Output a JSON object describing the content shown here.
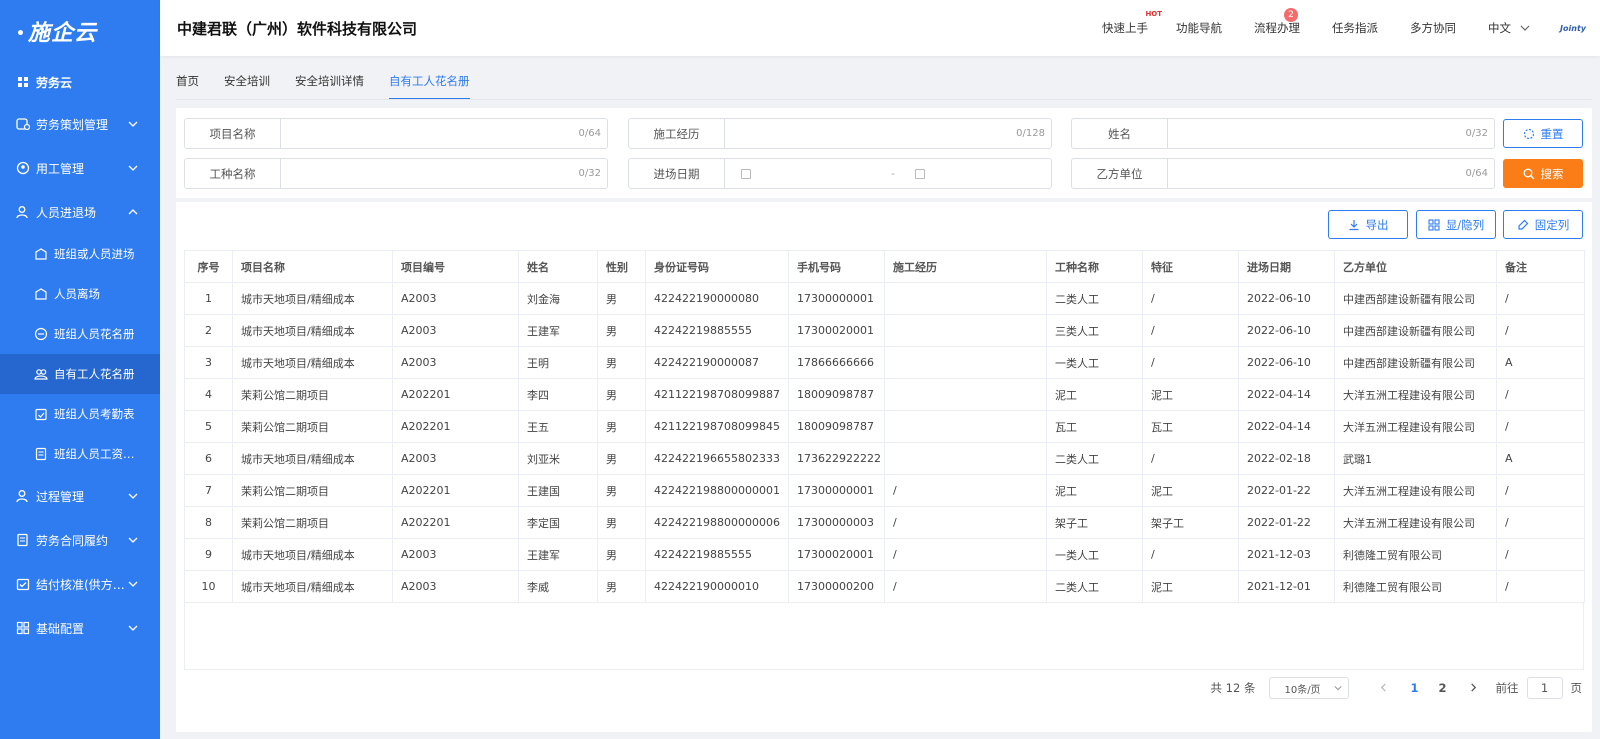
{
  "brand": {
    "logo": "施企云"
  },
  "company": "中建君联（广州）软件科技有限公司",
  "header_nav": {
    "quick_start": "快速上手",
    "hot": "HOT",
    "feature_nav": "功能导航",
    "process": "流程办理",
    "process_badge": "2",
    "tasks": "任务指派",
    "collab": "多方协同",
    "lang": "中文",
    "brand_mini": "Jointy"
  },
  "sidebar": {
    "items": [
      {
        "label": "劳务云",
        "icon": "grid-icon"
      },
      {
        "label": "劳务策划管理",
        "icon": "plan-icon"
      },
      {
        "label": "用工管理",
        "icon": "employ-icon"
      },
      {
        "label": "人员进退场",
        "icon": "person-icon"
      },
      {
        "label": "过程管理",
        "icon": "process-icon"
      },
      {
        "label": "劳务合同履约",
        "icon": "contract-icon"
      },
      {
        "label": "结付核准(供方报)",
        "icon": "payment-icon"
      },
      {
        "label": "基础配置",
        "icon": "config-icon"
      }
    ],
    "sub_items": [
      {
        "label": "班组或人员进场"
      },
      {
        "label": "人员离场"
      },
      {
        "label": "班组人员花名册"
      },
      {
        "label": "自有工人花名册"
      },
      {
        "label": "班组人员考勤表"
      },
      {
        "label": "班组人员工资发..."
      }
    ]
  },
  "tabs": [
    "首页",
    "安全培训",
    "安全培训详情",
    "自有工人花名册"
  ],
  "filters": {
    "project_name": {
      "label": "项目名称",
      "counter": "0/64"
    },
    "experience": {
      "label": "施工经历",
      "counter": "0/128"
    },
    "name": {
      "label": "姓名",
      "counter": "0/32"
    },
    "trade": {
      "label": "工种名称",
      "counter": "0/32"
    },
    "entry_date": {
      "label": "进场日期",
      "separator": "-"
    },
    "party_b": {
      "label": "乙方单位",
      "counter": "0/64"
    },
    "reset": "重置",
    "search": "搜索"
  },
  "toolbar": {
    "export": "导出",
    "show_hide": "显/隐列",
    "pin": "固定列"
  },
  "table": {
    "headers": [
      "序号",
      "项目名称",
      "项目编号",
      "姓名",
      "性别",
      "身份证号码",
      "手机号码",
      "施工经历",
      "工种名称",
      "特征",
      "进场日期",
      "乙方单位",
      "备注"
    ],
    "rows": [
      [
        "1",
        "城市天地项目/精细成本",
        "A2003",
        "刘金海",
        "男",
        "422422190000080",
        "17300000001",
        "",
        "二类人工",
        "/",
        "2022-06-10",
        "中建西部建设新疆有限公司",
        "/"
      ],
      [
        "2",
        "城市天地项目/精细成本",
        "A2003",
        "王建军",
        "男",
        "42242219885555",
        "17300020001",
        "",
        "三类人工",
        "/",
        "2022-06-10",
        "中建西部建设新疆有限公司",
        "/"
      ],
      [
        "3",
        "城市天地项目/精细成本",
        "A2003",
        "王明",
        "男",
        "422422190000087",
        "17866666666",
        "",
        "一类人工",
        "/",
        "2022-06-10",
        "中建西部建设新疆有限公司",
        "A"
      ],
      [
        "4",
        "茉莉公馆二期项目",
        "A202201",
        "李四",
        "男",
        "421122198708099887",
        "18009098787",
        "",
        "泥工",
        "泥工",
        "2022-04-14",
        "大洋五洲工程建设有限公司",
        "/"
      ],
      [
        "5",
        "茉莉公馆二期项目",
        "A202201",
        "王五",
        "男",
        "421122198708099845",
        "18009098787",
        "",
        "瓦工",
        "瓦工",
        "2022-04-14",
        "大洋五洲工程建设有限公司",
        "/"
      ],
      [
        "6",
        "城市天地项目/精细成本",
        "A2003",
        "刘亚米",
        "男",
        "422422196655802333",
        "173622922222",
        "",
        "二类人工",
        "/",
        "2022-02-18",
        "武璐1",
        "A"
      ],
      [
        "7",
        "茉莉公馆二期项目",
        "A202201",
        "王建国",
        "男",
        "422422198800000001",
        "17300000001",
        "/",
        "泥工",
        "泥工",
        "2022-01-22",
        "大洋五洲工程建设有限公司",
        "/"
      ],
      [
        "8",
        "茉莉公馆二期项目",
        "A202201",
        "李定国",
        "男",
        "422422198800000006",
        "17300000003",
        "/",
        "架子工",
        "架子工",
        "2022-01-22",
        "大洋五洲工程建设有限公司",
        "/"
      ],
      [
        "9",
        "城市天地项目/精细成本",
        "A2003",
        "王建军",
        "男",
        "42242219885555",
        "17300020001",
        "/",
        "一类人工",
        "/",
        "2021-12-03",
        "利德隆工贸有限公司",
        "/"
      ],
      [
        "10",
        "城市天地项目/精细成本",
        "A2003",
        "李威",
        "男",
        "422422190000010",
        "17300000200",
        "/",
        "二类人工",
        "泥工",
        "2021-12-01",
        "利德隆工贸有限公司",
        "/"
      ]
    ]
  },
  "pagination": {
    "total": "共 12 条",
    "page_size": "10条/页",
    "pages": [
      "1",
      "2"
    ],
    "goto_prefix": "前往",
    "goto_value": "1",
    "goto_suffix": "页"
  },
  "colors": {
    "sidebar": "#2f7cf0",
    "sidebar_active": "#2566cf",
    "accent": "#2f7cf0",
    "search": "#fa7d18",
    "badge": "#f56c6c"
  }
}
